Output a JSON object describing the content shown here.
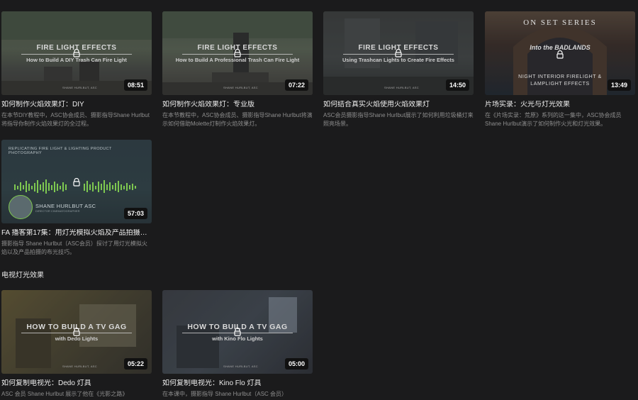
{
  "cards": [
    {
      "thumb_title": "FIRE LIGHT EFFECTS",
      "thumb_sub": "How to Build A DIY Trash Can Fire Light",
      "thumb_brand": "SHANE HURLBUT, ASC",
      "duration": "08:51",
      "title": "如何制作火焰效果灯：DIY",
      "desc": "在本节DIY教程中，ASC协会成员、摄影指导Shane Hurlbut将指导你制作火焰效果灯的全过程。"
    },
    {
      "thumb_title": "FIRE LIGHT EFFECTS",
      "thumb_sub": "How to Build A Professional Trash Can Fire Light",
      "thumb_brand": "SHANE HURLBUT, ASC",
      "duration": "07:22",
      "title": "如何制作火焰效果灯：专业版",
      "desc": "在本节教程中，ASC协会成员、摄影指导Shane Hurlbut将演示如何借助Molette灯制作火焰效果灯。"
    },
    {
      "thumb_title": "FIRE LIGHT EFFECTS",
      "thumb_sub": "Using Trashcan Lights to Create Fire Effects",
      "thumb_brand": "SHANE HURLBUT, ASC",
      "duration": "14:50",
      "title": "如何结合真实火焰使用火焰效果灯",
      "desc": "ASC会员摄影指导Shane Hurlbut展示了如何利用垃圾桶灯来照亮场景。"
    },
    {
      "thumb_title": "ON SET SERIES",
      "thumb_logo": "Into the BADLANDS",
      "thumb_sub": "NIGHT INTERIOR FIRELIGHT & LAMPLIGHT EFFECTS",
      "duration": "13:49",
      "title": "片场实录：火光与灯光效果",
      "desc": "在《片场实录：荒原》系列的这一集中，ASC协会成员Shane Hurlbut演示了如何制作火光和灯光效果。"
    },
    {
      "thumb_title": "REPLICATING FIRE LIGHT & LIGHTING PRODUCT PHOTOGRAPHY",
      "thumb_sub": "SHANE HURLBUT ASC",
      "thumb_caption": "DIRECTOR CINEMATOGRAPHER",
      "duration": "57:03",
      "title": "FA 播客第17集：用灯光模拟火焰及产品拍摄…",
      "desc": "摄影指导 Shane Hurlbut（ASC会员）探讨了用灯光模拟火焰以及产品拍摄的布光技巧。"
    }
  ],
  "section": {
    "title": "电视灯光效果"
  },
  "tv_cards": [
    {
      "thumb_title": "HOW TO BUILD A TV GAG",
      "thumb_sub": "with Dedo Lights",
      "thumb_brand": "SHANE HURLBUT, ASC",
      "duration": "05:22",
      "title": "如何复制电视光：Dedo 灯具",
      "desc": "ASC 会员 Shane Hurlbut 展示了他在《光影之路》"
    },
    {
      "thumb_title": "HOW TO BUILD A TV GAG",
      "thumb_sub": "with Kino Flo Lights",
      "thumb_brand": "SHANE HURLBUT, ASC",
      "duration": "05:00",
      "title": "如何复制电视光：Kino Flo 灯具",
      "desc": "在本课中，摄影指导 Shane Hurlbut（ASC 会员）"
    }
  ],
  "colors": {
    "background": "#1b1b1c",
    "title": "#ececec",
    "desc": "#8e8e8e",
    "duration_bg": "#111111"
  },
  "icons": {
    "lock": "lock-icon"
  }
}
